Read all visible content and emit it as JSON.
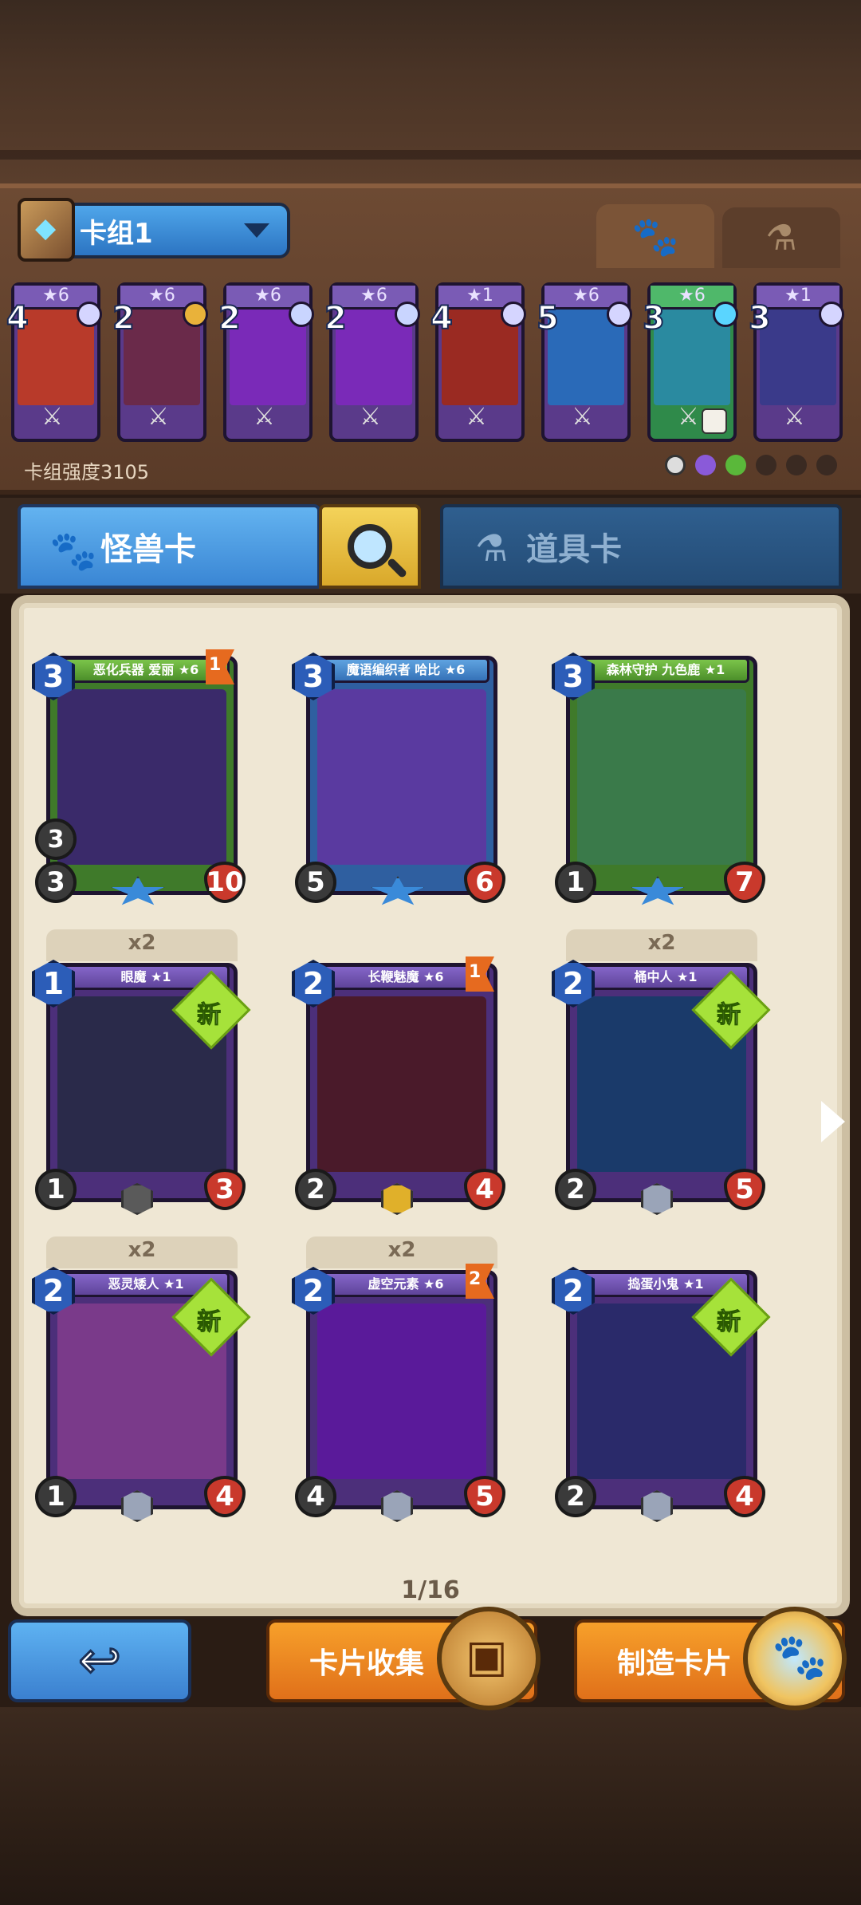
{
  "deck": {
    "selector_label": "卡组1",
    "strength_label": "卡组强度3105",
    "cards": [
      {
        "cost": "4",
        "stars": "★6",
        "art": "#b83a2a",
        "gem": "#d5d5ff"
      },
      {
        "cost": "2",
        "stars": "★6",
        "art": "#6a2a4a",
        "gem": "#e9b23a"
      },
      {
        "cost": "2",
        "stars": "★6",
        "art": "#7a2ab8",
        "gem": "#c9d5ff"
      },
      {
        "cost": "2",
        "stars": "★6",
        "art": "#7a2ab8",
        "gem": "#c9d5ff"
      },
      {
        "cost": "4",
        "stars": "★1",
        "art": "#9a2a22",
        "gem": "#d5d5ff"
      },
      {
        "cost": "5",
        "stars": "★6",
        "art": "#2a6ab8",
        "gem": "#d5d5ff"
      },
      {
        "cost": "3",
        "stars": "★6",
        "art": "#2a8aa0",
        "gem": "#5ad5ff"
      },
      {
        "cost": "3",
        "stars": "★1",
        "art": "#3a3a8a",
        "gem": "#d5d5ff"
      }
    ]
  },
  "tabs": {
    "monster_label": "怪兽卡",
    "item_label": "道具卡"
  },
  "collection": {
    "page_indicator": "1/16",
    "cards": [
      {
        "name": "恶化兵器 爱丽 ★6",
        "cost": "3",
        "atk": "3",
        "hp": "10",
        "spd": "3",
        "flag": "1",
        "color": "green",
        "art": "#3a2a6a",
        "rarity": "star"
      },
      {
        "name": "魔语编织者 哈比 ★6",
        "cost": "3",
        "atk": "5",
        "hp": "6",
        "spd": "",
        "flag": "",
        "color": "blue",
        "art": "#5a3aa0",
        "rarity": "star"
      },
      {
        "name": "森林守护 九色鹿 ★1",
        "cost": "3",
        "atk": "1",
        "hp": "7",
        "spd": "",
        "flag": "",
        "color": "green",
        "art": "#3a7a4a",
        "rarity": "star"
      },
      {
        "name": "眼魔 ★1",
        "cost": "1",
        "atk": "1",
        "hp": "3",
        "spd": "",
        "flag": "",
        "color": "purple",
        "art": "#2a2a4a",
        "rarity": "grey",
        "dup": "x2",
        "new": "新"
      },
      {
        "name": "长鞭魅魔 ★6",
        "cost": "2",
        "atk": "2",
        "hp": "4",
        "spd": "",
        "flag": "1",
        "color": "purple",
        "art": "#4a1a2a",
        "rarity": "gold"
      },
      {
        "name": "桶中人 ★1",
        "cost": "2",
        "atk": "2",
        "hp": "5",
        "spd": "",
        "flag": "",
        "color": "purple",
        "art": "#1a3a6a",
        "rarity": "silver",
        "dup": "x2",
        "new": "新"
      },
      {
        "name": "恶灵矮人 ★1",
        "cost": "2",
        "atk": "1",
        "hp": "4",
        "spd": "",
        "flag": "",
        "color": "purple",
        "art": "#7a3a8a",
        "rarity": "silver",
        "dup": "x2",
        "new": "新"
      },
      {
        "name": "虚空元素 ★6",
        "cost": "2",
        "atk": "4",
        "hp": "5",
        "spd": "",
        "flag": "2",
        "color": "purple",
        "art": "#5a1a9a",
        "rarity": "silver",
        "dup": "x2"
      },
      {
        "name": "捣蛋小鬼 ★1",
        "cost": "2",
        "atk": "2",
        "hp": "4",
        "spd": "",
        "flag": "",
        "color": "purple",
        "art": "#2a2a6a",
        "rarity": "silver",
        "new": "新"
      }
    ]
  },
  "buttons": {
    "collect_label": "卡片收集",
    "craft_label": "制造卡片"
  }
}
